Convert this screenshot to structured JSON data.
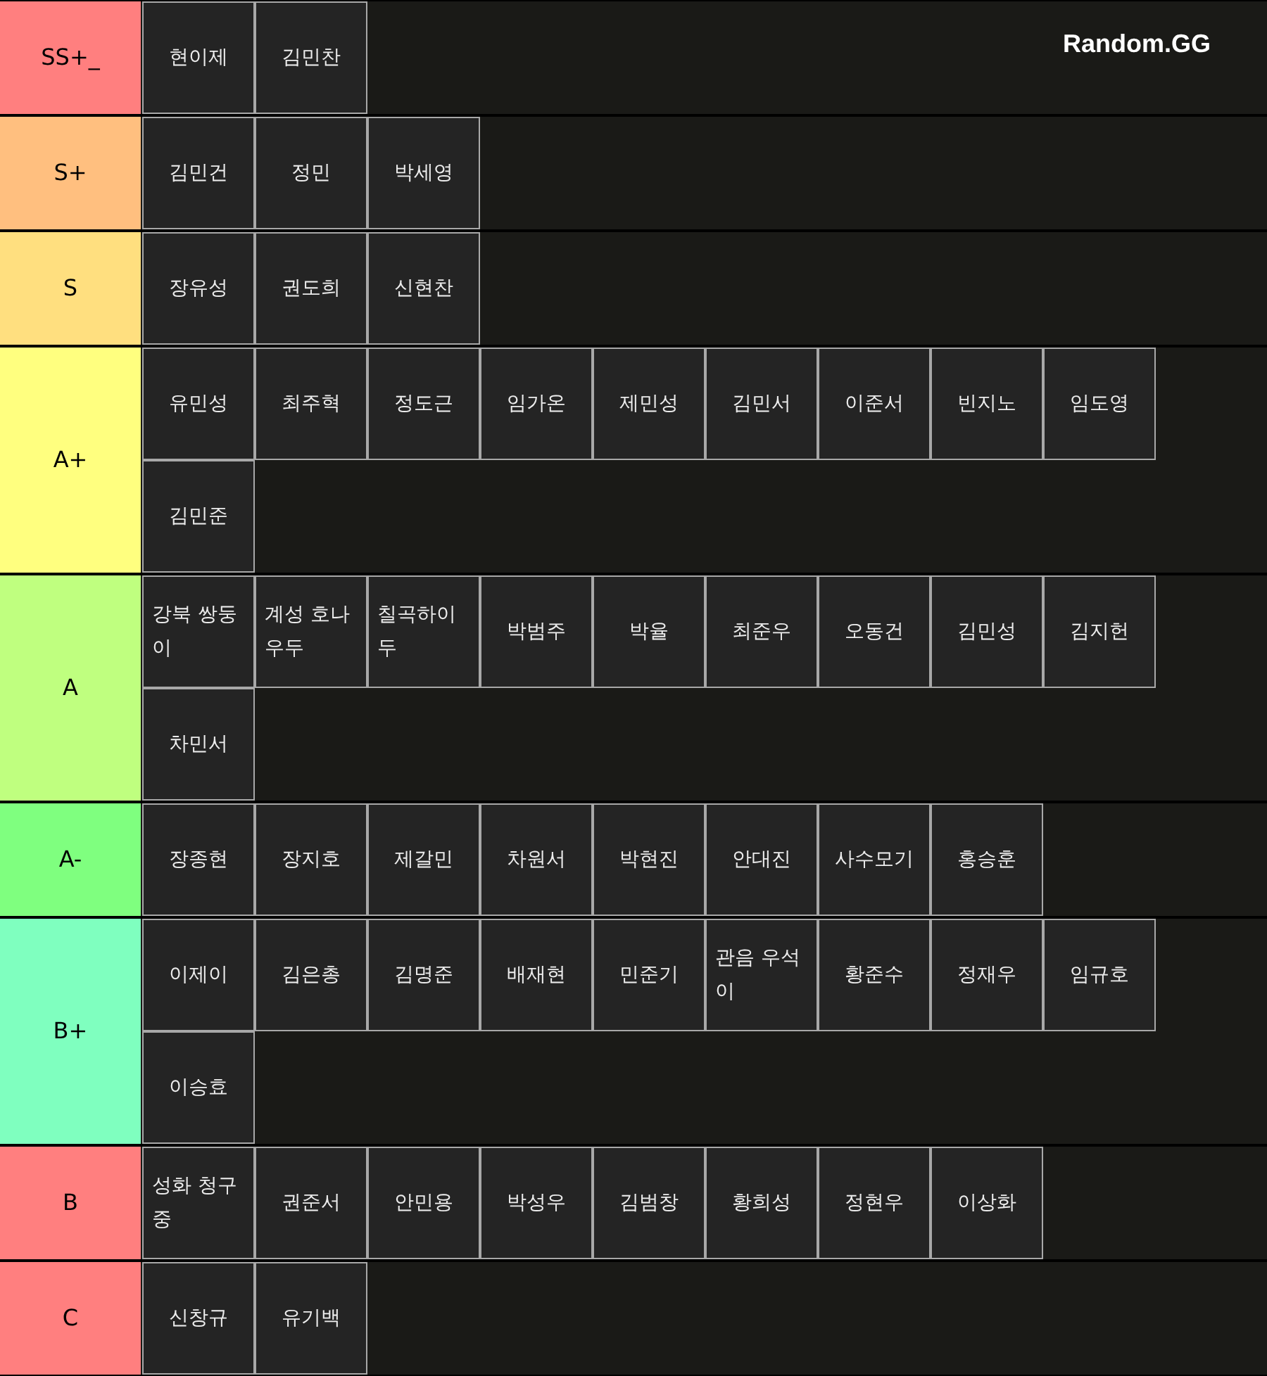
{
  "logo": "Random.GG",
  "tiers": [
    {
      "label": "SS+_",
      "color": "#ff7f7f",
      "items": [
        "현이제",
        "김민찬"
      ]
    },
    {
      "label": "S+",
      "color": "#ffbf7f",
      "items": [
        "김민건",
        "정민",
        "박세영"
      ]
    },
    {
      "label": "S",
      "color": "#ffdf7f",
      "items": [
        "장유성",
        "권도희",
        "신현찬"
      ]
    },
    {
      "label": "A+",
      "color": "#ffff7f",
      "items": [
        "유민성",
        "최주혁",
        "정도근",
        "임가온",
        "제민성",
        "김민서",
        "이준서",
        "빈지노",
        "임도영",
        "김민준"
      ]
    },
    {
      "label": "A",
      "color": "#bfff7f",
      "items": [
        "강북 쌍둥이",
        "계성 호나우두",
        "칠곡하이두",
        "박범주",
        "박율",
        "최준우",
        "오동건",
        "김민성",
        "김지헌",
        "차민서"
      ]
    },
    {
      "label": "A-",
      "color": "#7fff7f",
      "items": [
        "장종현",
        "장지호",
        "제갈민",
        "차원서",
        "박현진",
        "안대진",
        "사수모기",
        "홍승훈"
      ]
    },
    {
      "label": "B+",
      "color": "#7fffbf",
      "items": [
        "이제이",
        "김은총",
        "김명준",
        "배재현",
        "민준기",
        "관음 우석이",
        "황준수",
        "정재우",
        "임규호",
        "이승효"
      ]
    },
    {
      "label": "B",
      "color": "#ff7f7f",
      "items": [
        "성화 청구중",
        "권준서",
        "안민용",
        "박성우",
        "김범창",
        "황희성",
        "정현우",
        "이상화"
      ]
    },
    {
      "label": "C",
      "color": "#ff7f7f",
      "items": [
        "신창규",
        "유기백"
      ]
    }
  ]
}
